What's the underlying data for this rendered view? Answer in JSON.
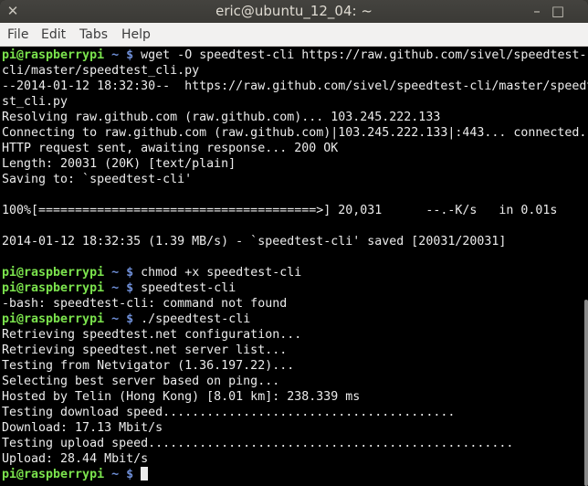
{
  "window": {
    "title": "eric@ubuntu_12_04: ~",
    "close_glyph": "✕",
    "minimize_glyph": "–",
    "maximize_glyph": "□"
  },
  "menu": {
    "file": "File",
    "edit": "Edit",
    "tabs": "Tabs",
    "help": "Help"
  },
  "colors": {
    "prompt_green": "#7be34d",
    "path_blue": "#6f8fd8",
    "text": "#ececec",
    "background": "#000000"
  },
  "prompt": {
    "user_host": "pi@raspberrypi",
    "path": "~",
    "symbol": "$"
  },
  "terminal": {
    "l1_cmd": "wget -O speedtest-cli https://raw.github.com/sivel/speedtest-",
    "l2": "cli/master/speedtest_cli.py",
    "l3": "--2014-01-12 18:32:30--  https://raw.github.com/sivel/speedtest-cli/master/speedte",
    "l4": "st_cli.py",
    "l5": "Resolving raw.github.com (raw.github.com)... 103.245.222.133",
    "l6": "Connecting to raw.github.com (raw.github.com)|103.245.222.133|:443... connected.",
    "l7": "HTTP request sent, awaiting response... 200 OK",
    "l8": "Length: 20031 (20K) [text/plain]",
    "l9": "Saving to: `speedtest-cli'",
    "l10": "",
    "l11": "100%[======================================>] 20,031      --.-K/s   in 0.01s",
    "l12": "",
    "l13": "2014-01-12 18:32:35 (1.39 MB/s) - `speedtest-cli' saved [20031/20031]",
    "l14": "",
    "l15_cmd": "chmod +x speedtest-cli",
    "l16_cmd": "speedtest-cli",
    "l17": "-bash: speedtest-cli: command not found",
    "l18_cmd": "./speedtest-cli",
    "l19": "Retrieving speedtest.net configuration...",
    "l20": "Retrieving speedtest.net server list...",
    "l21": "Testing from Netvigator (1.36.197.22)...",
    "l22": "Selecting best server based on ping...",
    "l23": "Hosted by Telin (Hong Kong) [8.01 km]: 238.339 ms",
    "l24": "Testing download speed........................................",
    "l25": "Download: 17.13 Mbit/s",
    "l26": "Testing upload speed..................................................",
    "l27": "Upload: 28.44 Mbit/s",
    "l28_cmd": ""
  }
}
